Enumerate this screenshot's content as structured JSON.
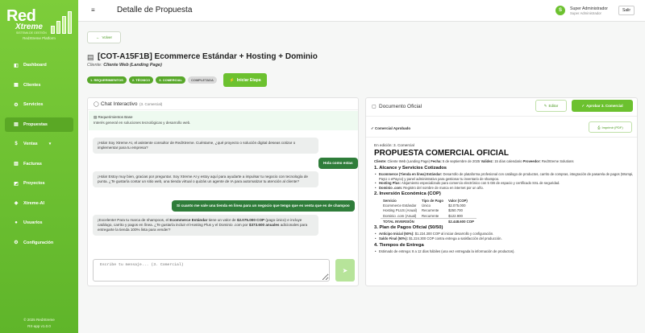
{
  "sidebar": {
    "logo_main": "Red",
    "logo_sub": "Xtreme",
    "logo_tag": "SISTEMA DE GESTIÓN",
    "platform": "RedXtreme Platform",
    "items": [
      {
        "label": "Dashboard",
        "icon": "dashboard-icon",
        "glyph": "◧"
      },
      {
        "label": "Clientes",
        "icon": "clients-icon",
        "glyph": "▦"
      },
      {
        "label": "Servicios",
        "icon": "services-icon",
        "glyph": "⚙"
      },
      {
        "label": "Propuestas",
        "icon": "proposals-icon",
        "glyph": "▤"
      },
      {
        "label": "Ventas",
        "icon": "sales-icon",
        "glyph": "$"
      },
      {
        "label": "Facturas",
        "icon": "invoices-icon",
        "glyph": "▥"
      },
      {
        "label": "Proyectos",
        "icon": "projects-icon",
        "glyph": "◩"
      },
      {
        "label": "Xtreme-AI",
        "icon": "ai-icon",
        "glyph": "◈"
      },
      {
        "label": "Usuarios",
        "icon": "users-icon",
        "glyph": "●"
      },
      {
        "label": "Configuración",
        "icon": "settings-icon",
        "glyph": "⚙"
      }
    ],
    "footer_copy": "© 2025 RedXtreme",
    "footer_version": "RX-app v1.0.0"
  },
  "topbar": {
    "title": "Detalle de Propuesta",
    "avatar_letter": "S",
    "user_name": "Super Administrador",
    "user_role": "Super Administrador",
    "logout": "Salir"
  },
  "header": {
    "back_label": "Volver",
    "proposal_title": "[COT-A15F1B] Ecommerce Estándar + Hosting + Dominio",
    "client_label": "Cliente:",
    "client_value": "Cliente Web (Landing Page)",
    "stages": [
      {
        "label": "1. REQUERIMIENTOS",
        "done": true
      },
      {
        "label": "2. TÉCNICO",
        "done": true
      },
      {
        "label": "3. COMERCIAL",
        "done": true
      },
      {
        "label": "COMPLETADA",
        "done": false
      }
    ],
    "start_stage": "Iniciar Etapa"
  },
  "chat": {
    "title": "Chat Interactivo",
    "stage": "(3. Comercial)",
    "req_title": "Requerimientos Base",
    "req_desc": "Interés general en soluciones tecnológicas y desarrollo web.",
    "messages": [
      {
        "role": "bot",
        "text": "¡Hola! Soy Xtreme AI, el asistente consultor de RedXtreme. Cuéntame, ¿qué proyecto o solución digital deseas cotizar o implementar para tu empresa?"
      },
      {
        "role": "user",
        "text": "Hola como estas"
      },
      {
        "role": "bot",
        "text": "¡Hola! Estoy muy bien, gracias por preguntar. Soy Xtreme AI y estoy aquí para ayudarte a impulsar tu negocio con tecnología de punta. ¿Te gustaría contar un sitio web, una tienda virtual o quizás un agente de IA para automatizar tu atención al cliente?"
      },
      {
        "role": "user",
        "text": "Si cuanto me vale una tienda en linea para un negocio que tengo que es venta que es de champoo"
      },
      {
        "role": "bot",
        "pre": "¡Excelente! Para tu marca de shampoos, el ",
        "b1": "Ecommerce Estándar",
        "mid": " tiene un valor de ",
        "b2": "$2.075.000 COP",
        "mid2": " (pago único) e incluye catálogo, carrito y pagos en línea. ¿Te gustaría incluir el Hosting Plus y el Dominio .com por ",
        "b3": "$373.600 anuales",
        "post": " adicionales para entregarte la tienda 100% lista para vender?"
      }
    ],
    "input_placeholder": "Escribe tu mensaje... (3. Comercial)"
  },
  "document": {
    "title": "Documento Oficial",
    "edit": "Editar",
    "approve": "Aprobar 3. Comercial",
    "approved_label": "Comercial Aprobado",
    "print": "Imprimir (PDF)",
    "edition": "En edición: 3. Comercial",
    "heading": "PROPUESTA COMERCIAL OFICIAL",
    "meta": {
      "client_k": "Cliente:",
      "client_v": "Cliente Web (Landing Page)",
      "date_k": "Fecha:",
      "date_v": "5 de septiembre de 2025",
      "valid_k": "Validez:",
      "valid_v": "15 días calendario",
      "prov_k": "Proveedor:",
      "prov_v": "RedXtreme Solutions"
    },
    "s1_title": "1. Alcance y Servicios Cotizados",
    "s1_items": [
      {
        "k": "Ecommerce (Tienda en línea) Estándar:",
        "v": "Desarrollo de plataforma profesional con catálogo de productos, carrito de compras, integración de pasarela de pagos (Wompi, PayU o ePayco) y panel administrativo para gestionar tu inventario de shampoo."
      },
      {
        "k": "Hosting Plus:",
        "v": "Alojamiento especializado para comercio electrónico con 5 GB de espacio y certificado SSL de seguridad."
      },
      {
        "k": "Dominio .com:",
        "v": "Registro del nombre de marca en internet por un año."
      }
    ],
    "s2_title": "2. Inversión Económica (COP)",
    "inv_headers": [
      "Servicio",
      "Tipo de Pago",
      "Valor (COP)"
    ],
    "inv_rows": [
      [
        "Ecommerce Estándar",
        "Único",
        "$2.075.000"
      ],
      [
        "Hosting PLUS (Anual)",
        "Recurrente",
        "$250.700"
      ],
      [
        "Dominio .com (Anual)",
        "Recurrente",
        "$122.900"
      ]
    ],
    "inv_total": [
      "TOTAL INVERSIÓN",
      "",
      "$2.448.600 COP"
    ],
    "s3_title": "3. Plan de Pagos Oficial (50/50)",
    "s3_items": [
      {
        "k": "Anticipo Inicial (50%):",
        "v": "$1.224.300 COP al iniciar desarrollo y configuración."
      },
      {
        "k": "Saldo Final (50%):",
        "v": "$1.224.300 COP contra entrega a satisfacción del producción."
      }
    ],
    "s4_title": "4. Tiempos de Entrega",
    "s4_items": [
      {
        "k": "",
        "v": "Estimado de entrega: 8 a 12 días hábiles (una vez entregada la información de productos)."
      }
    ]
  }
}
